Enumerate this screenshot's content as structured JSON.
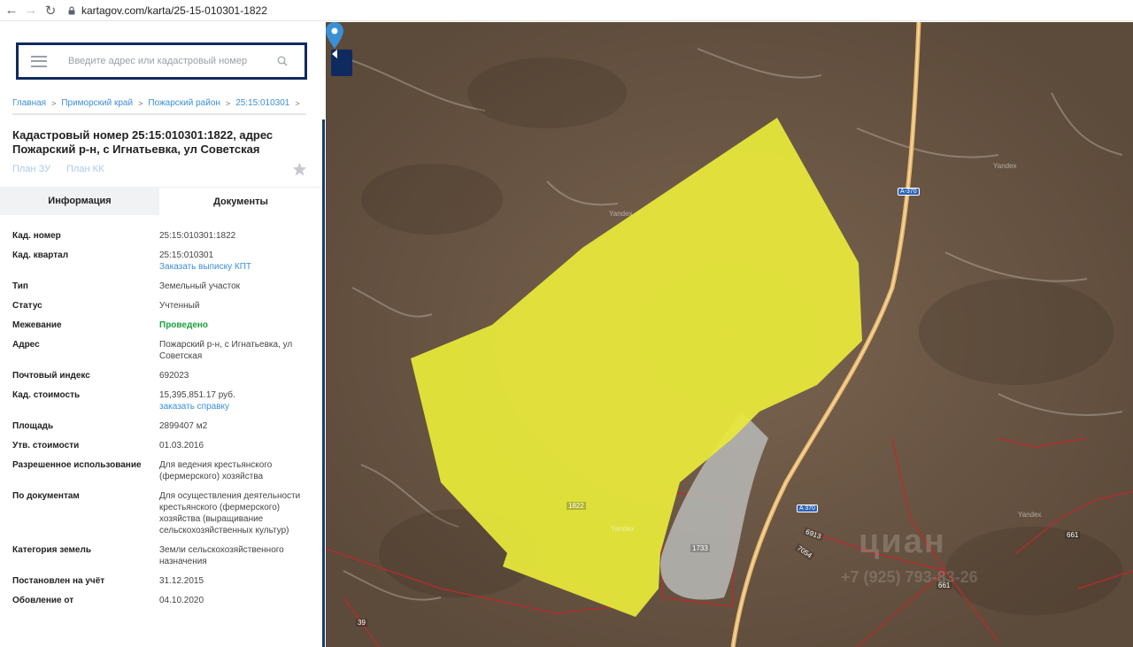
{
  "browser": {
    "url": "kartagov.com/karta/25-15-010301-1822"
  },
  "search": {
    "placeholder": "Введите адрес или кадастровый номер"
  },
  "breadcrumb": [
    "Главная",
    "Приморский край",
    "Пожарский район",
    "25:15:010301"
  ],
  "title": "Кадастровый номер 25:15:010301:1822, адрес Пожарский р-н, с Игнатьевка, ул Советская",
  "plan_links": [
    "План ЗУ",
    "План КК"
  ],
  "tabs": [
    "Информация",
    "Документы"
  ],
  "info": [
    {
      "label": "Кад. номер",
      "value": "25:15:010301:1822"
    },
    {
      "label": "Кад. квартал",
      "value": "25:15:010301",
      "link": "Заказать выписку КПТ"
    },
    {
      "label": "Тип",
      "value": "Земельный участок"
    },
    {
      "label": "Статус",
      "value": "Учтенный"
    },
    {
      "label": "Межевание",
      "value": "Проведено"
    },
    {
      "label": "Адрес",
      "value": "Пожарский р-н, с Игнатьевка, ул Советская"
    },
    {
      "label": "Почтовый индекс",
      "value": "692023"
    },
    {
      "label": "Кад. стоимость",
      "value": "15,395,851.17 руб.",
      "link": "заказать справку"
    },
    {
      "label": "Площадь",
      "value": "2899407 м2"
    },
    {
      "label": "Утв. стоимости",
      "value": "01.03.2016"
    },
    {
      "label": "Разрешенное использование",
      "value": "Для ведения крестьянского (фермерского) хозяйства"
    },
    {
      "label": "По документам",
      "value": "Для осуществления деятельности крестьянского (фермерского) хозяйства (выращивание сельскохозяйственных культур)"
    },
    {
      "label": "Категория земель",
      "value": "Земли сельскохозяйственного назначения"
    },
    {
      "label": "Постановлен на учёт",
      "value": "31.12.2015"
    },
    {
      "label": "Обовление от",
      "value": "04.10.2020"
    }
  ],
  "map": {
    "parcel_labels": [
      "1822",
      "1733",
      "6913",
      "7054",
      "661",
      "661",
      "39"
    ],
    "road_labels": [
      "A-370",
      "A 370"
    ],
    "yandex": "Yandex",
    "watermark": "циан",
    "watermark_phone": "+7 (925) 793-83-26",
    "colors": {
      "parcel": "#e8ea3a",
      "boundary": "#c0282a",
      "road": "#e8b76a"
    }
  }
}
